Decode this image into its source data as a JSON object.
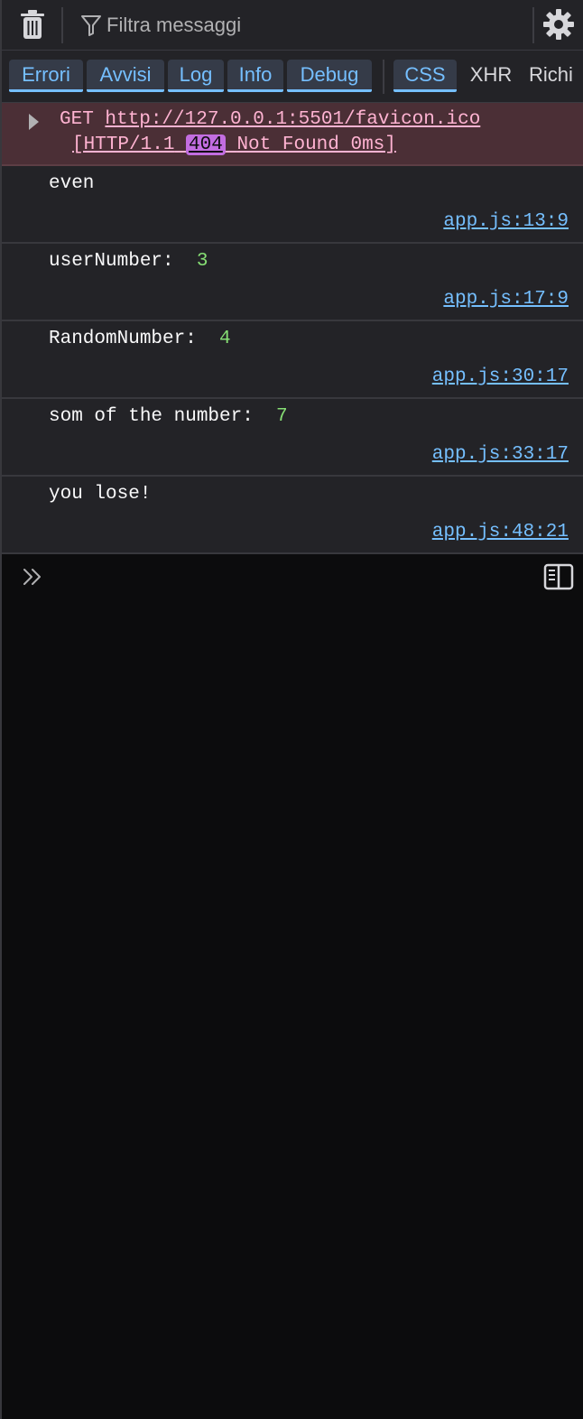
{
  "toolbar": {
    "clear_icon": "trash-icon",
    "filter_icon": "funnel-icon",
    "filter_placeholder": "Filtra messaggi",
    "settings_icon": "gear-icon"
  },
  "filters": {
    "errors": "Errori",
    "warnings": "Avvisi",
    "log": "Log",
    "info": "Info",
    "debug": "Debug",
    "css": "CSS",
    "xhr": "XHR",
    "requests": "Richi"
  },
  "network_error": {
    "method": "GET",
    "url": "http://127.0.0.1:5501/favicon.ico",
    "protocol": "[HTTP/1.1",
    "status": "404",
    "status_text": "Not Found 0ms]"
  },
  "messages": [
    {
      "text": "even",
      "value": "",
      "source": "app.js:13:9"
    },
    {
      "text": "userNumber:  ",
      "value": "3",
      "source": "app.js:17:9"
    },
    {
      "text": "RandomNumber:  ",
      "value": "4",
      "source": "app.js:30:17"
    },
    {
      "text": "som of the number:  ",
      "value": "7",
      "source": "app.js:33:17"
    },
    {
      "text": "you lose!",
      "value": "",
      "source": "app.js:48:21"
    }
  ],
  "input": {
    "prompt_icon": "double-chevron-right-icon",
    "sidebar_icon": "sidebar-toggle-icon",
    "value": ""
  },
  "colors": {
    "accent": "#75bfff",
    "error_bg": "#4b2f36",
    "error_text": "#ffb3d2",
    "number": "#86de74",
    "badge": "#c26de0",
    "panel_bg": "#232327",
    "console_bg": "#0c0c0d"
  }
}
